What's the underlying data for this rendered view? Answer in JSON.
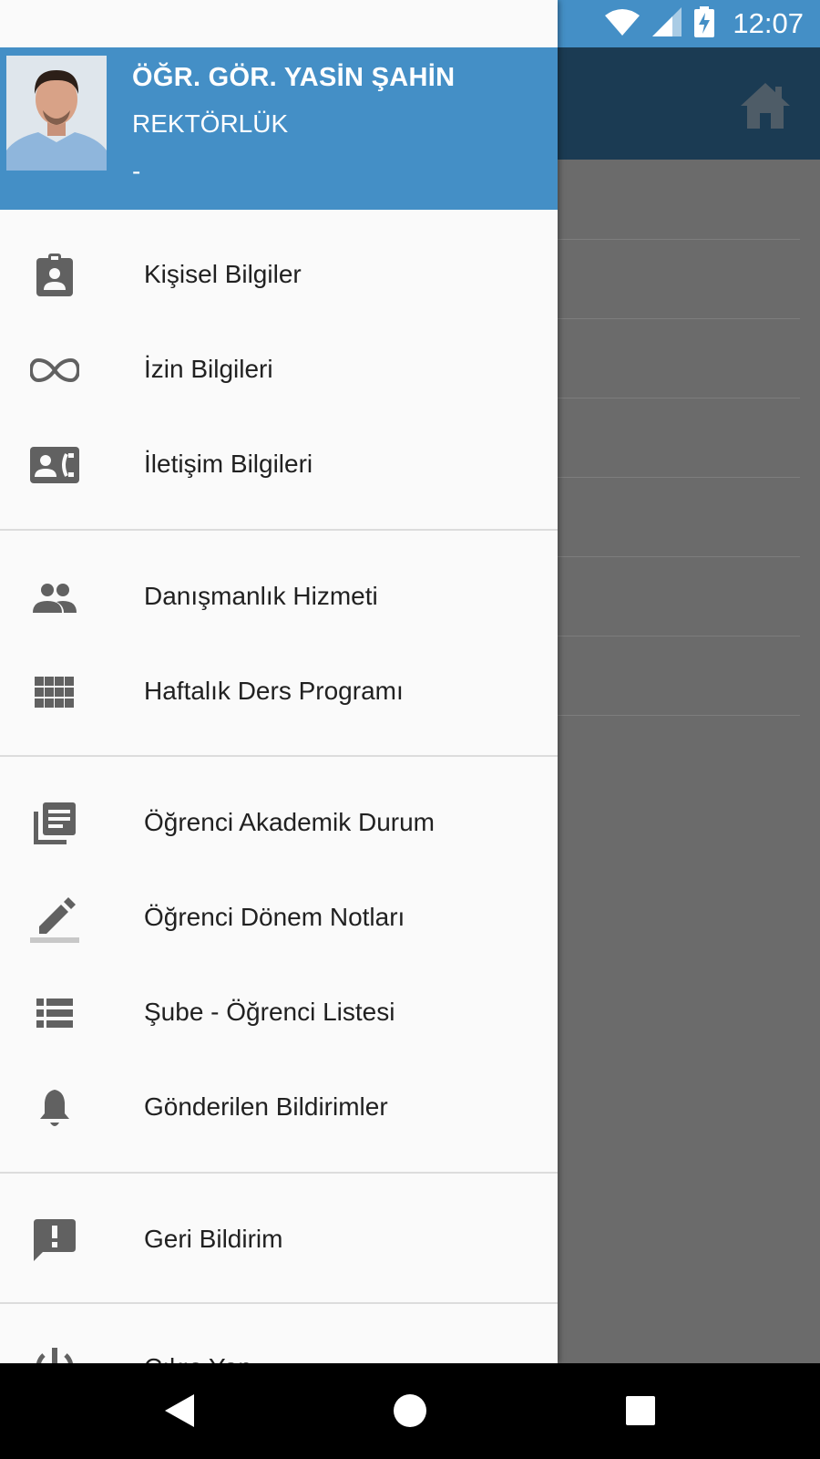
{
  "status_bar": {
    "time": "12:07",
    "icons": [
      "wifi-icon",
      "cell-signal-icon",
      "battery-charging-icon"
    ]
  },
  "background_app": {
    "toolbar_icon": "home-icon",
    "colors": {
      "toolbar": "#1b3b53",
      "scrim": "#6b6b6b"
    }
  },
  "drawer": {
    "header": {
      "name": "ÖĞR. GÖR. YASİN ŞAHİN",
      "unit": "REKTÖRLÜK",
      "extra": "-",
      "color": "#448fc6"
    },
    "groups": [
      {
        "items": [
          {
            "label": "Kişisel Bilgiler",
            "icon": "badge-icon"
          },
          {
            "label": "İzin Bilgileri",
            "icon": "infinity-icon"
          },
          {
            "label": "İletişim Bilgileri",
            "icon": "contact-phone-icon"
          }
        ]
      },
      {
        "items": [
          {
            "label": "Danışmanlık Hizmeti",
            "icon": "people-icon"
          },
          {
            "label": "Haftalık Ders Programı",
            "icon": "grid-icon"
          }
        ]
      },
      {
        "items": [
          {
            "label": "Öğrenci Akademik Durum",
            "icon": "library-books-icon"
          },
          {
            "label": "Öğrenci Dönem Notları",
            "icon": "edit-pencil-icon"
          },
          {
            "label": "Şube - Öğrenci Listesi",
            "icon": "list-icon"
          },
          {
            "label": "Gönderilen Bildirimler",
            "icon": "bell-icon"
          }
        ]
      },
      {
        "items": [
          {
            "label": "Geri Bildirim",
            "icon": "feedback-icon"
          }
        ]
      },
      {
        "items": [
          {
            "label": "Çıkış Yap",
            "icon": "power-icon"
          }
        ]
      }
    ]
  },
  "nav_bar": {
    "buttons": [
      "back-icon",
      "home-circle-icon",
      "recents-icon"
    ]
  }
}
